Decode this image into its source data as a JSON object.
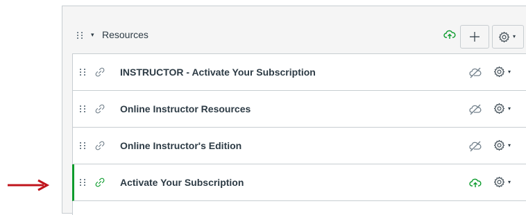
{
  "module": {
    "title": "Resources",
    "collapse_caret": "▾",
    "settings_caret": "▾",
    "colors": {
      "published": "#0b9b2c",
      "unpublished": "#73818c",
      "annotation_arrow": "#c0141c"
    }
  },
  "items": [
    {
      "title": "INSTRUCTOR - Activate Your Subscription",
      "type": "link",
      "status": "unpublished",
      "caret": "▾"
    },
    {
      "title": "Online Instructor Resources",
      "type": "link",
      "status": "unpublished",
      "caret": "▾"
    },
    {
      "title": "Online Instructor's Edition",
      "type": "link",
      "status": "unpublished",
      "caret": "▾"
    },
    {
      "title": "Activate Your Subscription",
      "type": "link",
      "status": "published",
      "caret": "▾"
    }
  ]
}
